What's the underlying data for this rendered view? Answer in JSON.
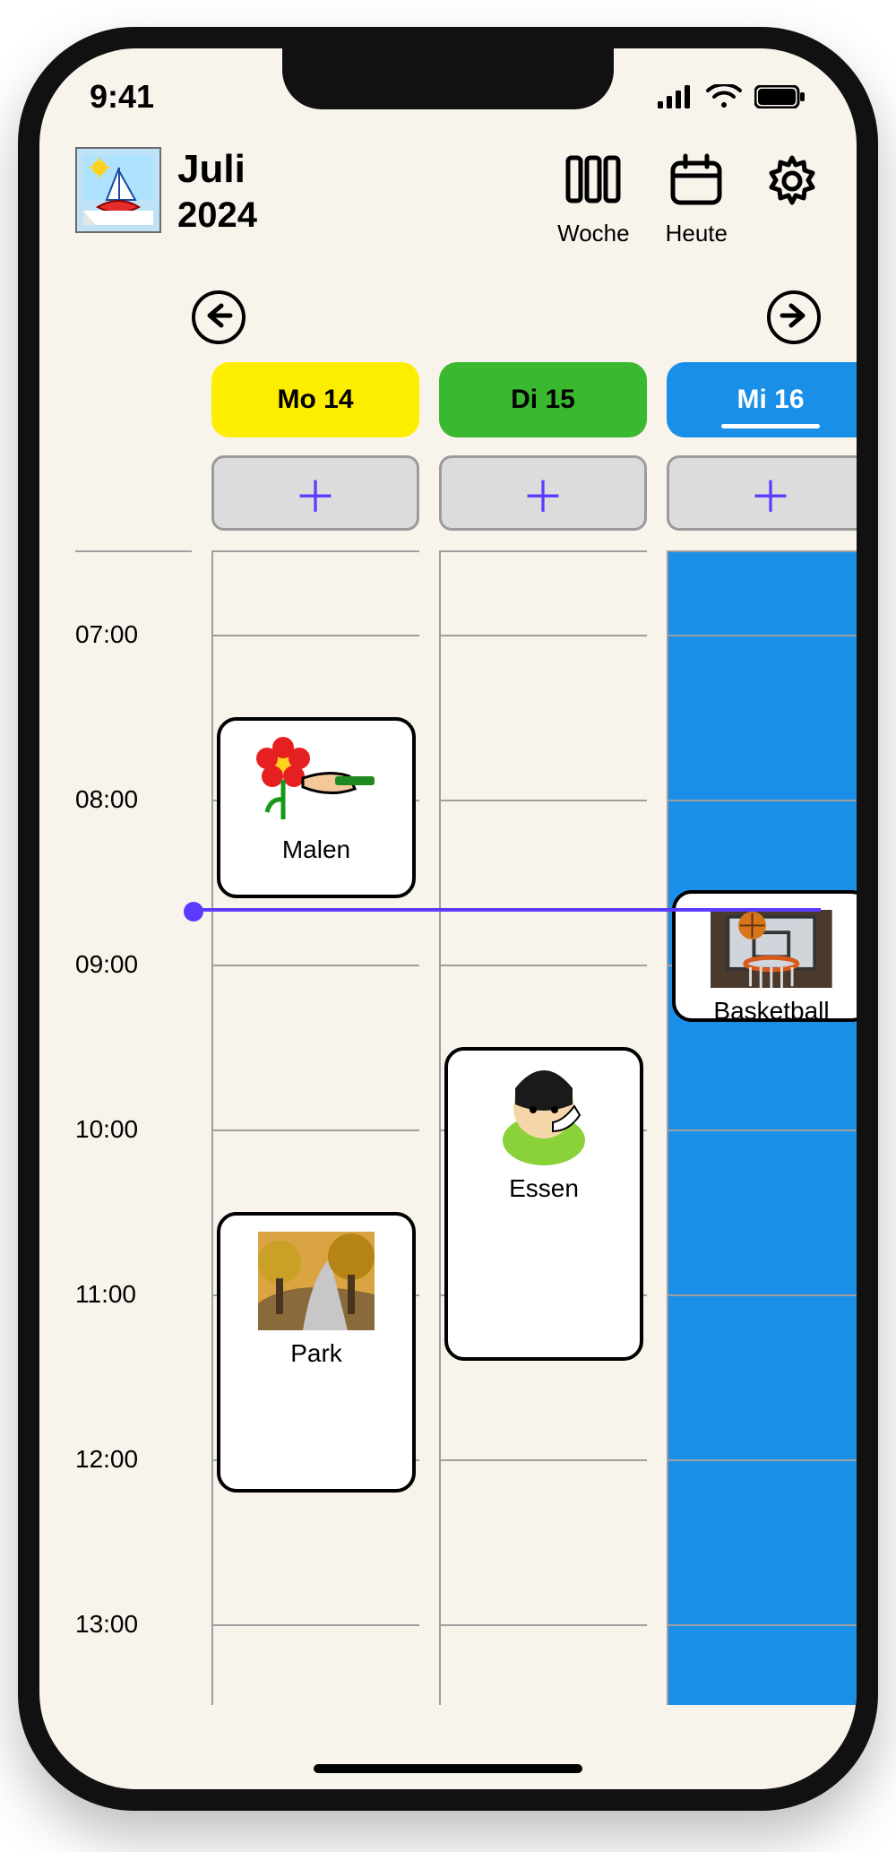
{
  "status": {
    "time": "9:41"
  },
  "header": {
    "month": "Juli",
    "year": "2024",
    "actions": {
      "week": "Woche",
      "today": "Heute"
    }
  },
  "days": [
    {
      "label": "Mo 14",
      "color": "#fdee00",
      "selected": false,
      "today": false
    },
    {
      "label": "Di 15",
      "color": "#3ab82f",
      "selected": false,
      "today": false
    },
    {
      "label": "Mi 16",
      "color": "#1a8fe7",
      "selected": true,
      "today": true,
      "text": "#ffffff"
    }
  ],
  "timeline": {
    "start_hour": 6.5,
    "end_hour": 13.5,
    "labels": [
      "07:00",
      "08:00",
      "09:00",
      "10:00",
      "11:00",
      "12:00",
      "13:00"
    ],
    "now_hour": 8.67
  },
  "events": [
    {
      "day": 0,
      "title": "Malen",
      "start": 7.5,
      "end": 8.6,
      "icon": "flower-paint"
    },
    {
      "day": 0,
      "title": "Park",
      "start": 10.5,
      "end": 12.2,
      "icon": "park-photo"
    },
    {
      "day": 1,
      "title": "Essen",
      "start": 9.5,
      "end": 11.4,
      "icon": "eating"
    },
    {
      "day": 2,
      "title": "Basketball",
      "start": 8.55,
      "end": 9.35,
      "icon": "basketball"
    }
  ],
  "colors": {
    "accent": "#5b3bff"
  }
}
